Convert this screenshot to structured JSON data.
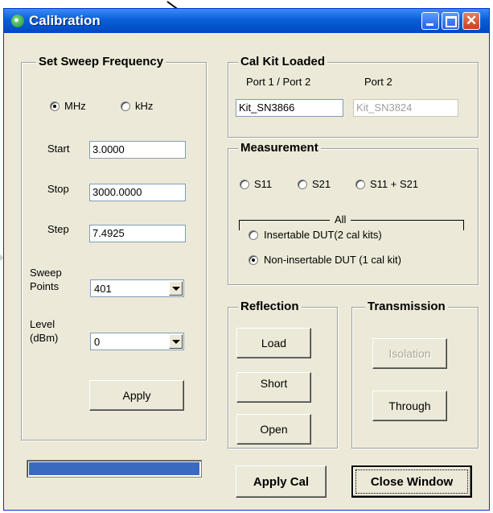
{
  "window": {
    "title": "Calibration"
  },
  "sweep": {
    "group_title": "Set Sweep Frequency",
    "unit_options": [
      "MHz",
      "kHz"
    ],
    "selected_unit": "MHz",
    "start_label": "Start",
    "start_value": "3.0000",
    "stop_label": "Stop",
    "stop_value": "3000.0000",
    "step_label": "Step",
    "step_value": "7.4925",
    "points_label_line1": "Sweep",
    "points_label_line2": "Points",
    "points_value": "401",
    "level_label_line1": "Level",
    "level_label_line2": "(dBm)",
    "level_value": "0",
    "apply_label": "Apply"
  },
  "cal_kit": {
    "group_title": "Cal Kit Loaded",
    "port1_label": "Port 1 / Port 2",
    "port1_value": "Kit_SN3866",
    "port2_label": "Port 2",
    "port2_value": "Kit_SN3824"
  },
  "measurement": {
    "group_title": "Measurement",
    "options": [
      "S11",
      "S21",
      "S11 + S21"
    ],
    "all_label": "All",
    "dut_options": [
      "Insertable DUT(2 cal kits)",
      "Non-insertable DUT (1 cal kit)"
    ],
    "selected_dut": "Non-insertable DUT (1 cal kit)"
  },
  "reflection": {
    "group_title": "Reflection",
    "load_label": "Load",
    "short_label": "Short",
    "open_label": "Open"
  },
  "transmission": {
    "group_title": "Transmission",
    "isolation_label": "Isolation",
    "through_label": "Through"
  },
  "footer": {
    "progress_fraction": 1.0,
    "apply_cal_label": "Apply Cal",
    "close_window_label": "Close Window"
  },
  "colors": {
    "titlebar": "#0a5fd8",
    "window_bg": "#ece9d8",
    "progress_fill": "#3a6ac0"
  }
}
